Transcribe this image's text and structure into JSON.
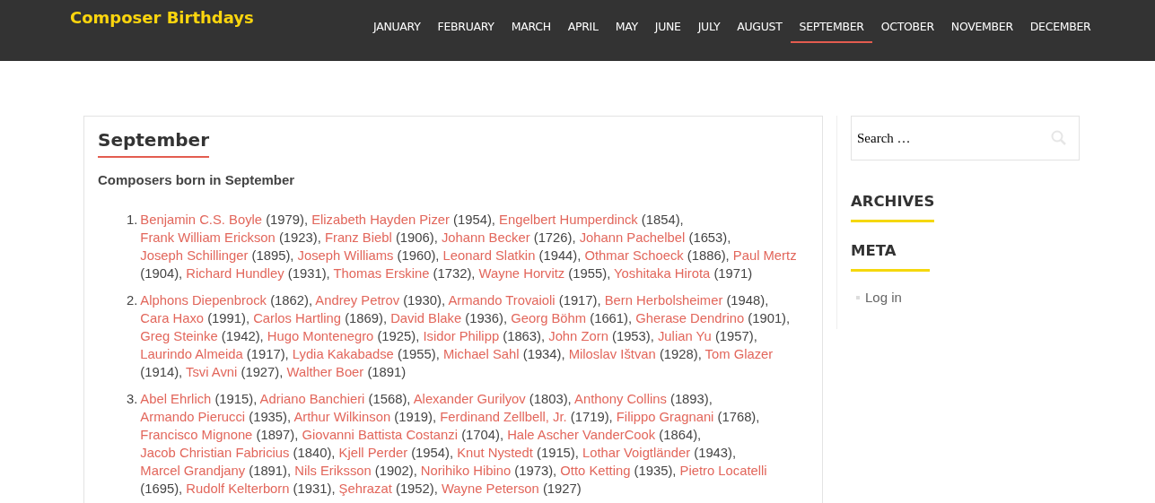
{
  "site_title": "Composer Birthdays",
  "nav": [
    {
      "label": "JANUARY",
      "selected": false
    },
    {
      "label": "FEBRUARY",
      "selected": false
    },
    {
      "label": "MARCH",
      "selected": false
    },
    {
      "label": "APRIL",
      "selected": false
    },
    {
      "label": "MAY",
      "selected": false
    },
    {
      "label": "JUNE",
      "selected": false
    },
    {
      "label": "JULY",
      "selected": false
    },
    {
      "label": "AUGUST",
      "selected": false
    },
    {
      "label": "SEPTEMBER",
      "selected": true
    },
    {
      "label": "OCTOBER",
      "selected": false
    },
    {
      "label": "NOVEMBER",
      "selected": false
    },
    {
      "label": "DECEMBER",
      "selected": false
    }
  ],
  "article": {
    "title": "September",
    "subtitle": "Composers born in September",
    "groups": [
      {
        "number": "1.",
        "entries": [
          {
            "name": "Benjamin C.S. Boyle",
            "note": " (1979), "
          },
          {
            "name": "Elizabeth Hayden Pizer",
            "note": " (1954), "
          },
          {
            "name": "Engelbert Humperdinck",
            "note": " (1854), "
          },
          {
            "name": "Frank William Erickson",
            "note": " (1923), "
          },
          {
            "name": "Franz Biebl",
            "note": " (1906), "
          },
          {
            "name": "Johann Becker",
            "note": " (1726), "
          },
          {
            "name": "Johann Pachelbel",
            "note": " (1653), "
          },
          {
            "name": "Joseph Schillinger",
            "note": " (1895), "
          },
          {
            "name": "Joseph Williams",
            "note": " (1960), "
          },
          {
            "name": "Leonard Slatkin",
            "note": " (1944), "
          },
          {
            "name": "Othmar Schoeck",
            "note": " (1886), "
          },
          {
            "name": "Paul Mertz",
            "note": " (1904), "
          },
          {
            "name": "Richard Hundley",
            "note": " (1931), "
          },
          {
            "name": "Thomas Erskine",
            "note": " (1732), "
          },
          {
            "name": "Wayne Horvitz",
            "note": " (1955), "
          },
          {
            "name": "Yoshitaka Hirota",
            "note": " (1971)"
          }
        ]
      },
      {
        "number": "2.",
        "entries": [
          {
            "name": "Alphons Diepenbrock",
            "note": " (1862), "
          },
          {
            "name": "Andrey Petrov",
            "note": " (1930), "
          },
          {
            "name": "Armando Trovaioli",
            "note": " (1917), "
          },
          {
            "name": "Bern Herbolsheimer",
            "note": " (1948), "
          },
          {
            "name": "Cara Haxo",
            "note": " (1991), "
          },
          {
            "name": "Carlos Hartling",
            "note": " (1869), "
          },
          {
            "name": "David Blake",
            "note": " (1936), "
          },
          {
            "name": "Georg Böhm",
            "note": " (1661), "
          },
          {
            "name": "Gherase Dendrino",
            "note": " (1901), "
          },
          {
            "name": "Greg Steinke",
            "note": " (1942), "
          },
          {
            "name": "Hugo Montenegro",
            "note": " (1925), "
          },
          {
            "name": "Isidor Philipp",
            "note": " (1863), "
          },
          {
            "name": "John Zorn",
            "note": " (1953), "
          },
          {
            "name": "Julian Yu",
            "note": " (1957), "
          },
          {
            "name": "Laurindo Almeida",
            "note": " (1917), "
          },
          {
            "name": "Lydia Kakabadse",
            "note": " (1955), "
          },
          {
            "name": "Michael Sahl",
            "note": " (1934), "
          },
          {
            "name": "Miloslav Ištvan",
            "note": " (1928), "
          },
          {
            "name": "Tom Glazer",
            "note": " (1914), "
          },
          {
            "name": "Tsvi Avni",
            "note": " (1927), "
          },
          {
            "name": "Walther Boer",
            "note": " (1891)"
          }
        ]
      },
      {
        "number": "3.",
        "entries": [
          {
            "name": "Abel Ehrlich",
            "note": " (1915), "
          },
          {
            "name": "Adriano Banchieri",
            "note": " (1568), "
          },
          {
            "name": "Alexander Gurilyov",
            "note": " (1803), "
          },
          {
            "name": "Anthony Collins",
            "note": " (1893), "
          },
          {
            "name": "Armando Pierucci",
            "note": " (1935), "
          },
          {
            "name": "Arthur Wilkinson",
            "note": " (1919), "
          },
          {
            "name": "Ferdinand Zellbell, Jr.",
            "note": " (1719), "
          },
          {
            "name": "Filippo Gragnani",
            "note": " (1768), "
          },
          {
            "name": "Francisco Mignone",
            "note": " (1897), "
          },
          {
            "name": "Giovanni Battista Costanzi",
            "note": " (1704), "
          },
          {
            "name": "Hale Ascher VanderCook",
            "note": " (1864), "
          },
          {
            "name": "Jacob Christian Fabricius",
            "note": " (1840), "
          },
          {
            "name": "Kjell Perder",
            "note": " (1954), "
          },
          {
            "name": "Knut Nystedt",
            "note": " (1915), "
          },
          {
            "name": "Lothar Voigtländer",
            "note": " (1943), "
          },
          {
            "name": "Marcel Grandjany",
            "note": " (1891), "
          },
          {
            "name": "Nils Eriksson",
            "note": " (1902), "
          },
          {
            "name": "Norihiko Hibino",
            "note": " (1973), "
          },
          {
            "name": "Otto Ketting",
            "note": " (1935), "
          },
          {
            "name": "Pietro Locatelli",
            "note": " (1695), "
          },
          {
            "name": "Rudolf Kelterborn",
            "note": " (1931), "
          },
          {
            "name": "Şehrazat",
            "note": " (1952), "
          },
          {
            "name": "Wayne Peterson",
            "note": " (1927)"
          }
        ]
      }
    ]
  },
  "sidebar": {
    "search": {
      "placeholder": "Search …"
    },
    "widgets": [
      {
        "title": "ARCHIVES"
      },
      {
        "title": "META",
        "items": [
          "Log in"
        ]
      }
    ]
  }
}
